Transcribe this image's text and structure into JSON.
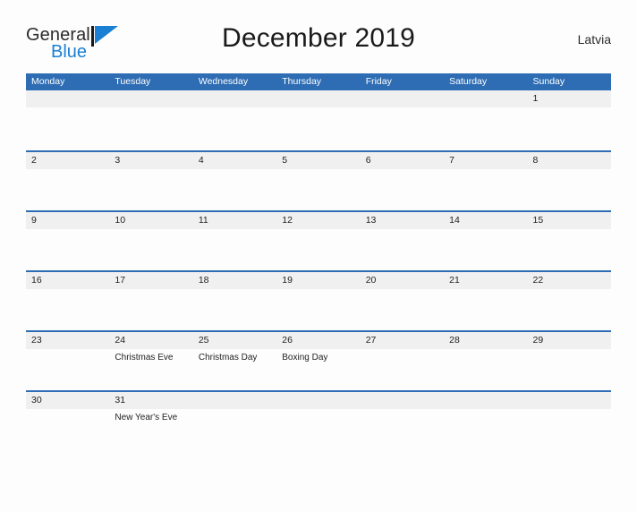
{
  "brand": {
    "name_part1": "General",
    "name_part2": "Blue",
    "flag_icon": "triangle-flag-icon",
    "color_primary": "#1b7fd4",
    "color_text": "#2b2b2b"
  },
  "header": {
    "title": "December 2019",
    "region": "Latvia"
  },
  "colors": {
    "header_blue": "#2e6db4",
    "row_divider_blue": "#2e6db4",
    "date_band_gray": "#f0f0f0",
    "page_background": "#fdfdfd",
    "text": "#1f1f1f"
  },
  "calendar": {
    "month": "December",
    "year": "2019",
    "weekday_headers": [
      "Monday",
      "Tuesday",
      "Wednesday",
      "Thursday",
      "Friday",
      "Saturday",
      "Sunday"
    ],
    "weeks": [
      [
        {
          "day": "",
          "events": []
        },
        {
          "day": "",
          "events": []
        },
        {
          "day": "",
          "events": []
        },
        {
          "day": "",
          "events": []
        },
        {
          "day": "",
          "events": []
        },
        {
          "day": "",
          "events": []
        },
        {
          "day": "1",
          "events": []
        }
      ],
      [
        {
          "day": "2",
          "events": []
        },
        {
          "day": "3",
          "events": []
        },
        {
          "day": "4",
          "events": []
        },
        {
          "day": "5",
          "events": []
        },
        {
          "day": "6",
          "events": []
        },
        {
          "day": "7",
          "events": []
        },
        {
          "day": "8",
          "events": []
        }
      ],
      [
        {
          "day": "9",
          "events": []
        },
        {
          "day": "10",
          "events": []
        },
        {
          "day": "11",
          "events": []
        },
        {
          "day": "12",
          "events": []
        },
        {
          "day": "13",
          "events": []
        },
        {
          "day": "14",
          "events": []
        },
        {
          "day": "15",
          "events": []
        }
      ],
      [
        {
          "day": "16",
          "events": []
        },
        {
          "day": "17",
          "events": []
        },
        {
          "day": "18",
          "events": []
        },
        {
          "day": "19",
          "events": []
        },
        {
          "day": "20",
          "events": []
        },
        {
          "day": "21",
          "events": []
        },
        {
          "day": "22",
          "events": []
        }
      ],
      [
        {
          "day": "23",
          "events": []
        },
        {
          "day": "24",
          "events": [
            "Christmas Eve"
          ]
        },
        {
          "day": "25",
          "events": [
            "Christmas Day"
          ]
        },
        {
          "day": "26",
          "events": [
            "Boxing Day"
          ]
        },
        {
          "day": "27",
          "events": []
        },
        {
          "day": "28",
          "events": []
        },
        {
          "day": "29",
          "events": []
        }
      ],
      [
        {
          "day": "30",
          "events": []
        },
        {
          "day": "31",
          "events": [
            "New Year's Eve"
          ]
        },
        {
          "day": "",
          "events": []
        },
        {
          "day": "",
          "events": []
        },
        {
          "day": "",
          "events": []
        },
        {
          "day": "",
          "events": []
        },
        {
          "day": "",
          "events": []
        }
      ]
    ]
  }
}
